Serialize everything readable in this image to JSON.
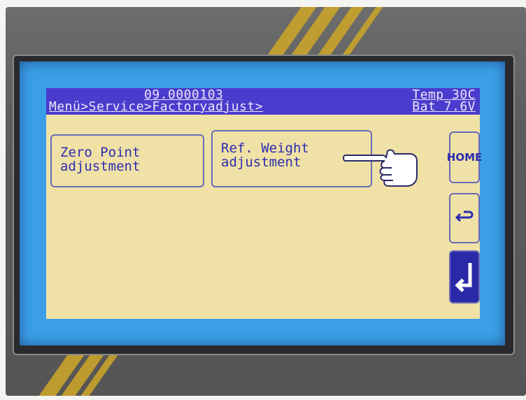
{
  "header": {
    "code": "09.0000103",
    "path": "Menü>Service>Factoryadjust>",
    "temp": "Temp 30C",
    "battery": "Bat 7.6V"
  },
  "buttons": {
    "zero": {
      "line1": "Zero Point",
      "line2": "adjustment"
    },
    "ref": {
      "line1": "Ref. Weight",
      "line2": "adjustment"
    },
    "home": "HOME"
  },
  "icons": {
    "back": "back-arrow-icon",
    "enter": "enter-arrow-icon",
    "pointer": "pointing-hand-icon"
  },
  "colors": {
    "lcd_blue": "#3a9fe6",
    "header_purple": "#4a3ccd",
    "panel_cream": "#f0e1a6",
    "text_blue": "#2c2cb0",
    "stripe_gold": "#c9a32a"
  }
}
